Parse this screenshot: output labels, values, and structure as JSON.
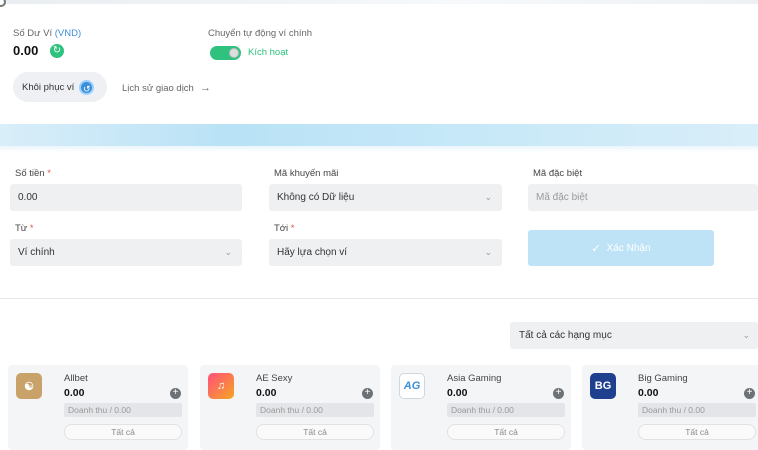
{
  "wallet": {
    "balance_label": "Số Dư Ví",
    "currency": "(VND)",
    "balance_value": "0.00",
    "auto_transfer_label": "Chuyển tự động ví chính",
    "auto_transfer_status": "Kích hoạt",
    "restore_label": "Khôi phục ví",
    "history_label": "Lịch sử giao dịch"
  },
  "form": {
    "amount_label": "Số tiền",
    "amount_value": "0.00",
    "promo_label": "Mã khuyến mãi",
    "promo_value": "Không có Dữ liệu",
    "special_label": "Mã đặc biệt",
    "special_placeholder": "Mã đặc biệt",
    "from_label": "Từ",
    "from_value": "Ví chính",
    "to_label": "Tới",
    "to_value": "Hãy lựa chọn ví",
    "confirm_label": "Xác Nhận",
    "required_mark": "*"
  },
  "category_filter": "Tất cả các hạng mục",
  "providers": [
    {
      "name": "Allbet",
      "amount": "0.00",
      "turnover": "Doanh thu / 0.00",
      "all": "Tất cả",
      "color": "#c9a26a",
      "icon": "allbet-logo-icon"
    },
    {
      "name": "AE Sexy",
      "amount": "0.00",
      "turnover": "Doanh thu / 0.00",
      "all": "Tất cả",
      "color": "#f0763a",
      "icon": "ae-sexy-logo-icon"
    },
    {
      "name": "Asia Gaming",
      "amount": "0.00",
      "turnover": "Doanh thu / 0.00",
      "all": "Tất cả",
      "color": "#3b8fd9",
      "icon": "asia-gaming-logo-icon",
      "logo_text": "AG"
    },
    {
      "name": "Big Gaming",
      "amount": "0.00",
      "turnover": "Doanh thu / 0.00",
      "all": "Tất cả",
      "color": "#1f3f8f",
      "icon": "big-gaming-logo-icon",
      "logo_text": "BG"
    }
  ],
  "colors": {
    "accent_green": "#2ec27e",
    "accent_blue": "#3b8fd9",
    "confirm_bg": "#bfe3f6"
  }
}
